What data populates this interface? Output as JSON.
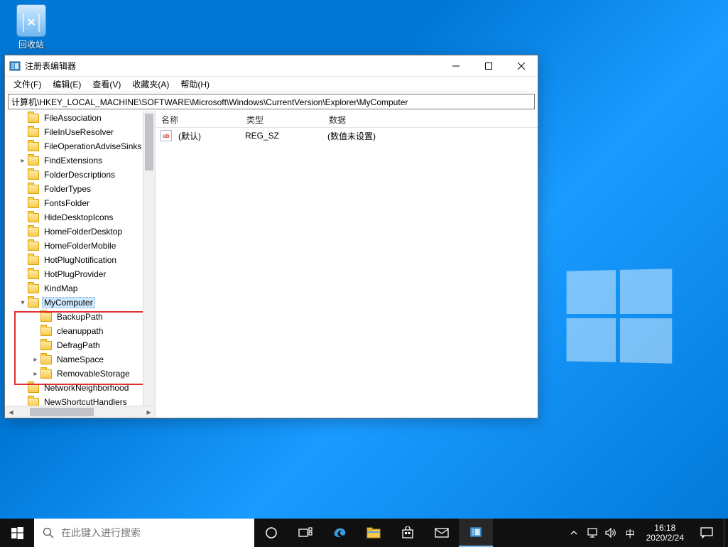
{
  "desktop": {
    "recycle_bin": "回收站"
  },
  "window": {
    "title": "注册表编辑器",
    "controls": {
      "minimize": "—",
      "maximize": "☐",
      "close": "✕"
    },
    "menu": [
      "文件(F)",
      "编辑(E)",
      "查看(V)",
      "收藏夹(A)",
      "帮助(H)"
    ],
    "address": "计算机\\HKEY_LOCAL_MACHINE\\SOFTWARE\\Microsoft\\Windows\\CurrentVersion\\Explorer\\MyComputer",
    "tree": {
      "items": [
        {
          "indent": 1,
          "twisty": "",
          "label": "FileAssociation"
        },
        {
          "indent": 1,
          "twisty": "",
          "label": "FileInUseResolver"
        },
        {
          "indent": 1,
          "twisty": "",
          "label": "FileOperationAdviseSinks"
        },
        {
          "indent": 1,
          "twisty": "▸",
          "label": "FindExtensions"
        },
        {
          "indent": 1,
          "twisty": "",
          "label": "FolderDescriptions"
        },
        {
          "indent": 1,
          "twisty": "",
          "label": "FolderTypes"
        },
        {
          "indent": 1,
          "twisty": "",
          "label": "FontsFolder"
        },
        {
          "indent": 1,
          "twisty": "",
          "label": "HideDesktopIcons"
        },
        {
          "indent": 1,
          "twisty": "",
          "label": "HomeFolderDesktop"
        },
        {
          "indent": 1,
          "twisty": "",
          "label": "HomeFolderMobile"
        },
        {
          "indent": 1,
          "twisty": "",
          "label": "HotPlugNotification"
        },
        {
          "indent": 1,
          "twisty": "",
          "label": "HotPlugProvider"
        },
        {
          "indent": 1,
          "twisty": "",
          "label": "KindMap"
        },
        {
          "indent": 1,
          "twisty": "▾",
          "label": "MyComputer",
          "selected": true
        },
        {
          "indent": 2,
          "twisty": "",
          "label": "BackupPath"
        },
        {
          "indent": 2,
          "twisty": "",
          "label": "cleanuppath"
        },
        {
          "indent": 2,
          "twisty": "",
          "label": "DefragPath"
        },
        {
          "indent": 2,
          "twisty": "▸",
          "label": "NameSpace"
        },
        {
          "indent": 2,
          "twisty": "▸",
          "label": "RemovableStorage"
        },
        {
          "indent": 1,
          "twisty": "",
          "label": "NetworkNeighborhood"
        },
        {
          "indent": 1,
          "twisty": "",
          "label": "NewShortcutHandlers"
        }
      ]
    },
    "columns": {
      "name": "名称",
      "type": "类型",
      "data": "数据"
    },
    "rows": [
      {
        "icon_text": "ab",
        "name": "(默认)",
        "type": "REG_SZ",
        "data": "(数值未设置)"
      }
    ]
  },
  "taskbar": {
    "search_placeholder": "在此键入进行搜索",
    "ime": "中",
    "time": "16:18",
    "date": "2020/2/24"
  }
}
